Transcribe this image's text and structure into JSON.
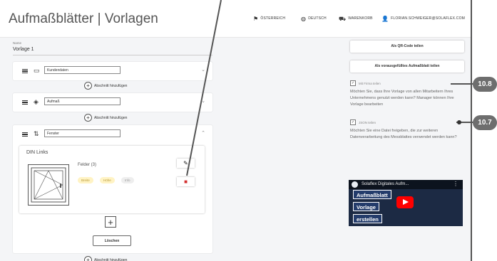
{
  "header": {
    "title": "Aufmaßblätter | Vorlagen",
    "nav": {
      "region": "ÖSTERREICH",
      "language": "DEUTSCH",
      "cart": "WARENKORB",
      "user": "FLORIAN.SCHWEIGER@SOLAFLEX.COM"
    }
  },
  "name_field": {
    "label": "Name",
    "value": "Vorlage 1"
  },
  "sections": [
    {
      "name": "Kundendaten",
      "icon": "card-icon",
      "expanded": false
    },
    {
      "name": "Aufmaß",
      "icon": "layers-icon",
      "expanded": false
    },
    {
      "name": "Fenster",
      "icon": "window-type-icon",
      "expanded": true
    }
  ],
  "add_section_label": "Abschnitt hinzufügen",
  "window_card": {
    "title": "DIN Links",
    "fields_label": "Felder (3)",
    "chips": [
      "Breite",
      "Höhe",
      "Info"
    ]
  },
  "delete_label": "Löschen",
  "right_panel": {
    "qr_button": "Als QR-Code teilen",
    "share_prefilled_button": "Als vorausgefülltes Aufmaßblatt teilen",
    "share_company": {
      "label": "Mit Firma teilen",
      "checked": true,
      "description": "Möchten Sie, dass Ihre Vorlage von allen Mitarbeitern Ihres Unternehmens genutzt werden kann? Manager können Ihre Vorlage bearbeiten"
    },
    "share_json": {
      "label": "JSON teilen",
      "checked": true,
      "description": "Möchten Sie eine Datei freigeben, die zur weiteren Datenverarbeitung des Messblattes verwendet werden kann?"
    },
    "video": {
      "title": "Aufmaßblatt Vorlage erstellen",
      "overlay_title": "Solaflex Digitales Aufm...",
      "lines": [
        "Aufmaßblatt",
        "Vorlage",
        "erstellen"
      ]
    }
  },
  "callouts": [
    "10.8",
    "10.7"
  ],
  "colors": {
    "accent_chip": "#fff3c4",
    "chip_grey": "#eeeeee",
    "delete_red": "#d32f2f",
    "youtube_red": "#ff0000"
  }
}
